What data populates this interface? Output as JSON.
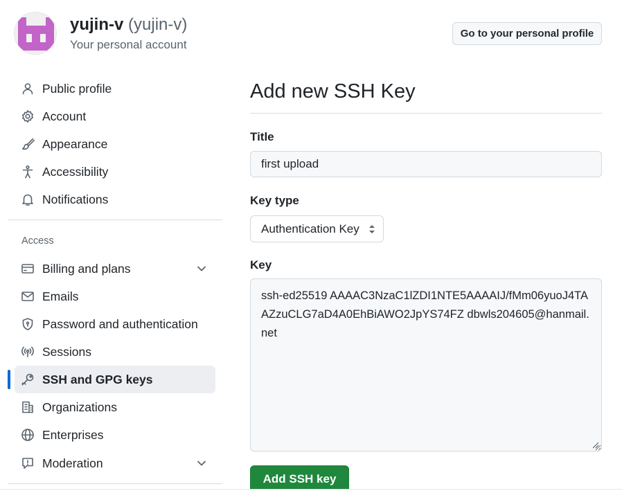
{
  "account": {
    "username": "yujin-v",
    "handle": "(yujin-v)",
    "subtitle": "Your personal account",
    "profile_button": "Go to your personal profile"
  },
  "sidebar": {
    "items": [
      {
        "label": "Public profile",
        "icon": "person-icon"
      },
      {
        "label": "Account",
        "icon": "gear-icon"
      },
      {
        "label": "Appearance",
        "icon": "paintbrush-icon"
      },
      {
        "label": "Accessibility",
        "icon": "accessibility-icon"
      },
      {
        "label": "Notifications",
        "icon": "bell-icon"
      }
    ],
    "access_heading": "Access",
    "access_items": [
      {
        "label": "Billing and plans",
        "icon": "credit-card-icon",
        "expandable": true
      },
      {
        "label": "Emails",
        "icon": "mail-icon"
      },
      {
        "label": "Password and authentication",
        "icon": "shield-lock-icon"
      },
      {
        "label": "Sessions",
        "icon": "broadcast-icon"
      },
      {
        "label": "SSH and GPG keys",
        "icon": "key-icon",
        "active": true
      },
      {
        "label": "Organizations",
        "icon": "organization-icon"
      },
      {
        "label": "Enterprises",
        "icon": "globe-icon"
      },
      {
        "label": "Moderation",
        "icon": "report-icon",
        "expandable": true
      }
    ]
  },
  "form": {
    "heading": "Add new SSH Key",
    "title_label": "Title",
    "title_value": "first upload",
    "key_type_label": "Key type",
    "key_type_value": "Authentication Key",
    "key_label": "Key",
    "key_value": "ssh-ed25519 AAAAC3NzaC1lZDI1NTE5AAAAIJ/fMm06yuoJ4TAAZzuCLG7aD4A0EhBiAWO2JpYS74FZ dbwls204605@hanmail.net",
    "submit_label": "Add SSH key"
  },
  "colors": {
    "accent_blue": "#0969da",
    "primary_green": "#1f883d",
    "avatar_purple": "#c264c8"
  }
}
